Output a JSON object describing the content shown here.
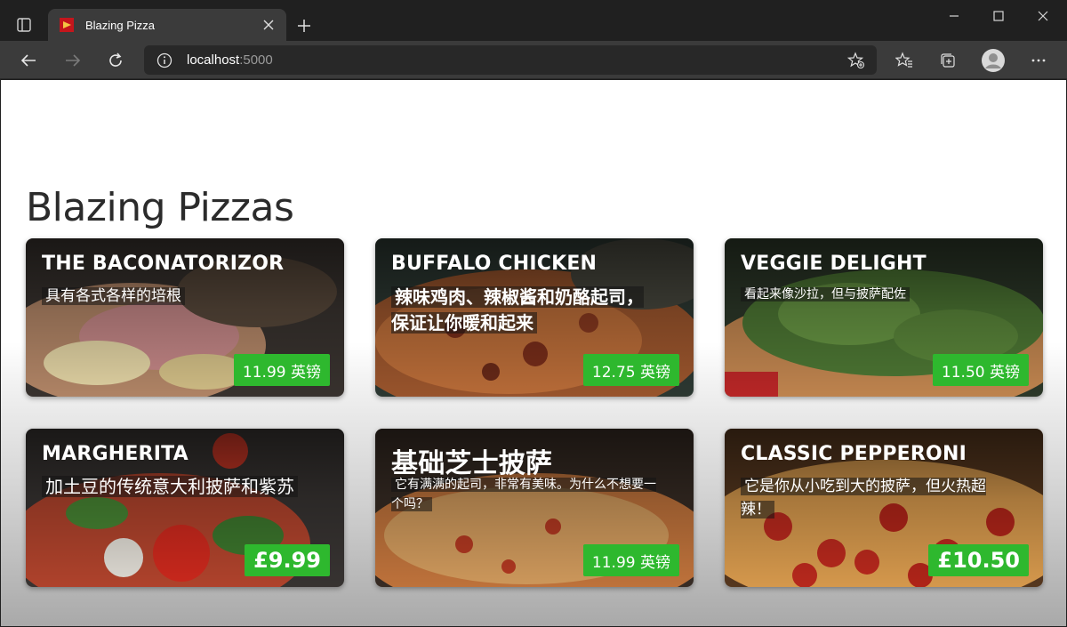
{
  "browser": {
    "tab_title": "Blazing Pizza",
    "url_host": "localhost",
    "url_port": ":5000"
  },
  "page": {
    "title": "Blazing Pizzas"
  },
  "colors": {
    "price_badge": "#2eb82e",
    "favicon": "#c4161c"
  },
  "specials": [
    {
      "name": "THE BACONATORIZOR",
      "description": "具有各式各样的培根",
      "price": "11.99 英镑"
    },
    {
      "name": "BUFFALO CHICKEN",
      "description": "辣味鸡肉、辣椒酱和奶酪起司，保证让你暖和起来",
      "price": "12.75 英镑"
    },
    {
      "name": "VEGGIE DELIGHT",
      "description": "看起来像沙拉，但与披萨配佐",
      "price": "11.50 英镑"
    },
    {
      "name": "MARGHERITA",
      "description": "加土豆的传统意大利披萨和紫苏",
      "price": "£9.99"
    },
    {
      "name": "基础芝士披萨",
      "description": "它有满满的起司，非常有美味。为什么不想要一个吗？",
      "price": "11.99 英镑"
    },
    {
      "name": "CLASSIC PEPPERONI",
      "description": "它是你从小吃到大的披萨，但火热超辣！",
      "price": "£10.50"
    }
  ]
}
